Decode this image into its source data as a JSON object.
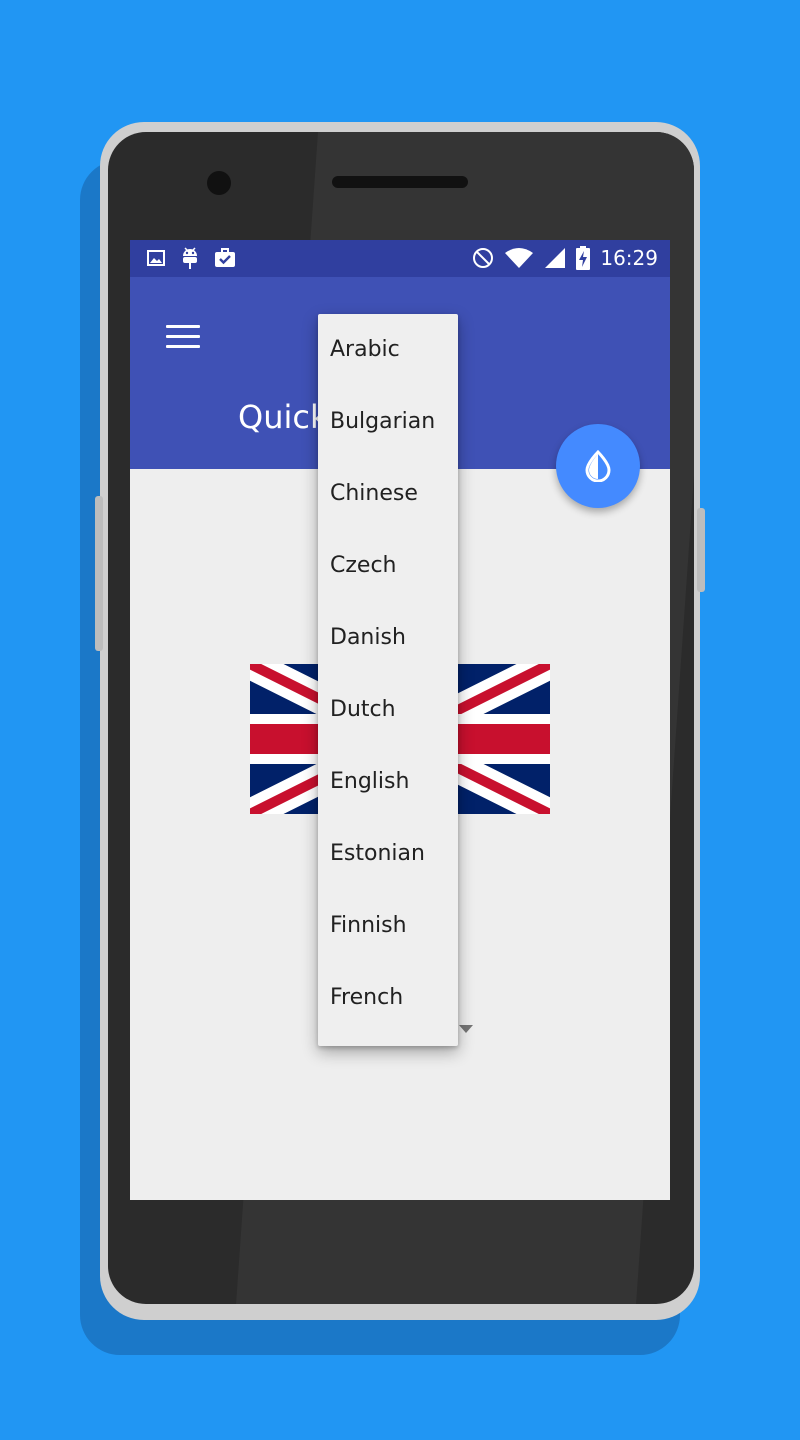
{
  "status_bar": {
    "time": "16:29",
    "left_icons": [
      "image-icon",
      "android-debug-icon",
      "briefcase-check-icon"
    ],
    "right_icons": [
      "do-not-disturb-icon",
      "wifi-icon",
      "signal-icon",
      "battery-charging-icon"
    ]
  },
  "app_bar": {
    "title": "Quick",
    "menu_icon": "hamburger-menu-icon"
  },
  "fab": {
    "icon": "drop-icon"
  },
  "flag": {
    "icon": "uk-flag-icon"
  },
  "dropdown": {
    "items": [
      "Arabic",
      "Bulgarian",
      "Chinese",
      "Czech",
      "Danish",
      "Dutch",
      "English",
      "Estonian",
      "Finnish",
      "French"
    ]
  },
  "colors": {
    "background": "#2196f3",
    "status_bar": "#303f9f",
    "app_bar": "#3f51b5",
    "fab": "#448aff",
    "screen": "#eeeeee"
  }
}
